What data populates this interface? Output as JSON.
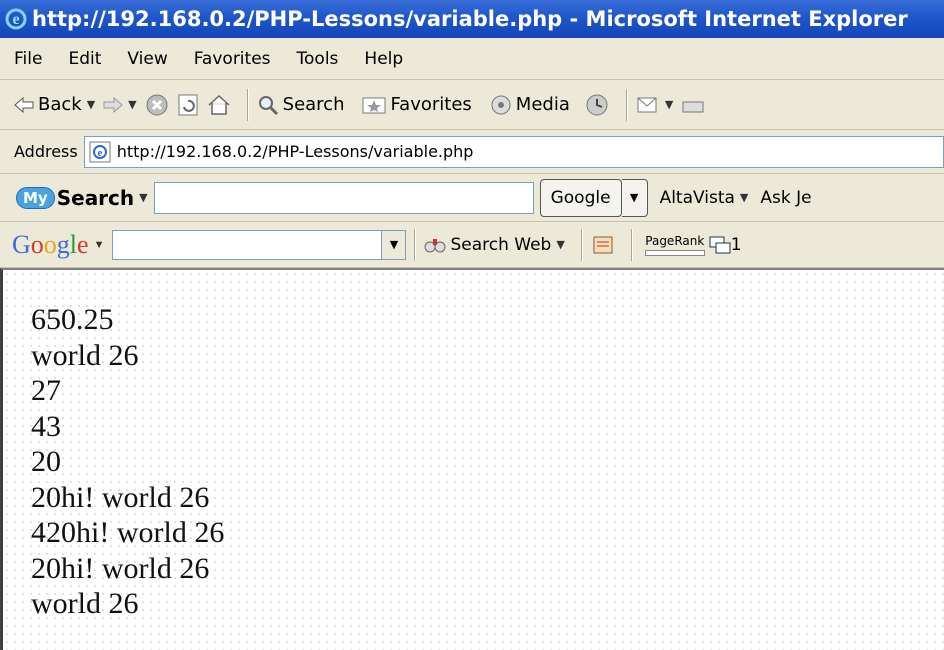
{
  "window": {
    "title": "http://192.168.0.2/PHP-Lessons/variable.php - Microsoft Internet Explorer",
    "icon": "ie-icon"
  },
  "menubar": {
    "items": [
      "File",
      "Edit",
      "View",
      "Favorites",
      "Tools",
      "Help"
    ]
  },
  "toolbar": {
    "back_label": "Back",
    "search_label": "Search",
    "favorites_label": "Favorites",
    "media_label": "Media"
  },
  "address": {
    "label": "Address",
    "url": "http://192.168.0.2/PHP-Lessons/variable.php"
  },
  "mysearch": {
    "logo_text": "Search",
    "logo_badge": "My",
    "input_value": "",
    "google_button": "Google",
    "altavista_label": "AltaVista",
    "askjeeves_label": "Ask Je"
  },
  "googlebar": {
    "logo": [
      "G",
      "o",
      "o",
      "g",
      "l",
      "e"
    ],
    "input_value": "",
    "search_web_label": "Search Web",
    "pagerank_label": "PageRank",
    "trailing_text": "1"
  },
  "page": {
    "lines": [
      "650.25",
      "world 26",
      "27",
      "43",
      "20",
      "20hi! world 26",
      "420hi! world 26",
      "20hi! world 26",
      "world 26"
    ]
  },
  "colors": {
    "titlebar": "#1f56c9",
    "chrome": "#ece9d8",
    "google_blue": "#3c6ad8",
    "google_red": "#d23b26",
    "google_yellow": "#e7a713",
    "google_green": "#2c9a3f"
  }
}
